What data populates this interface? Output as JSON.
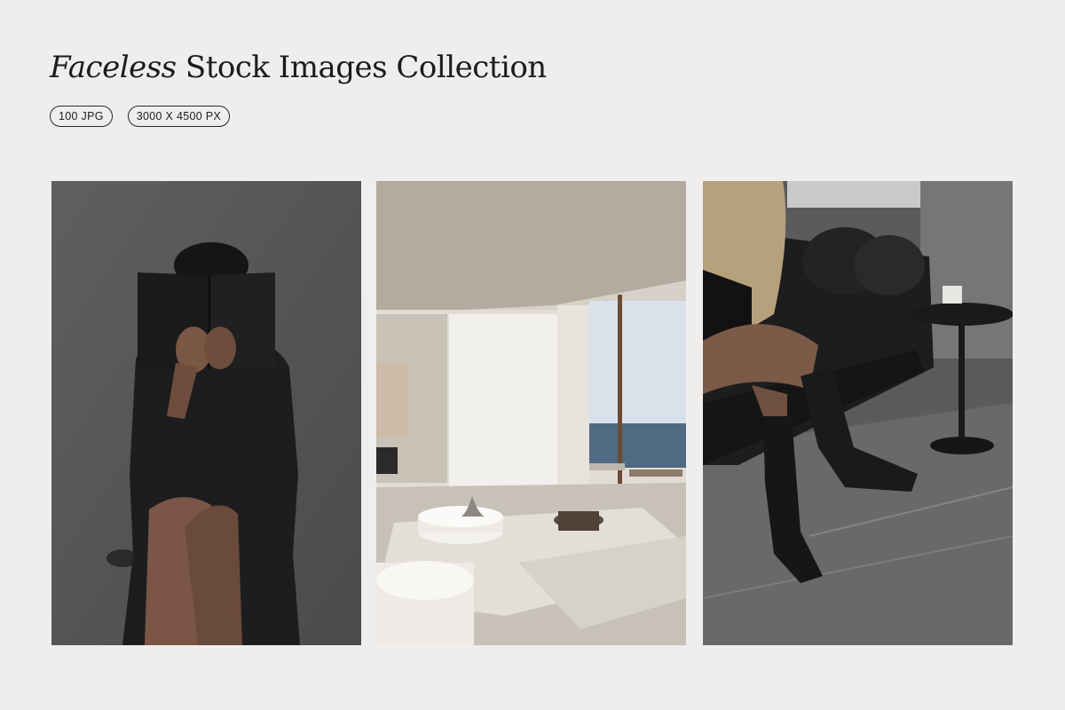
{
  "title": {
    "italic": "Faceless",
    "rest": "Stock Images Collection"
  },
  "badges": [
    "100 JPG",
    "3000 X 4500 PX"
  ],
  "photos": [
    {
      "name": "woman-reading-book-photo"
    },
    {
      "name": "minimal-living-room-sea-view-photo"
    },
    {
      "name": "woman-boots-leather-sofa-photo"
    }
  ]
}
